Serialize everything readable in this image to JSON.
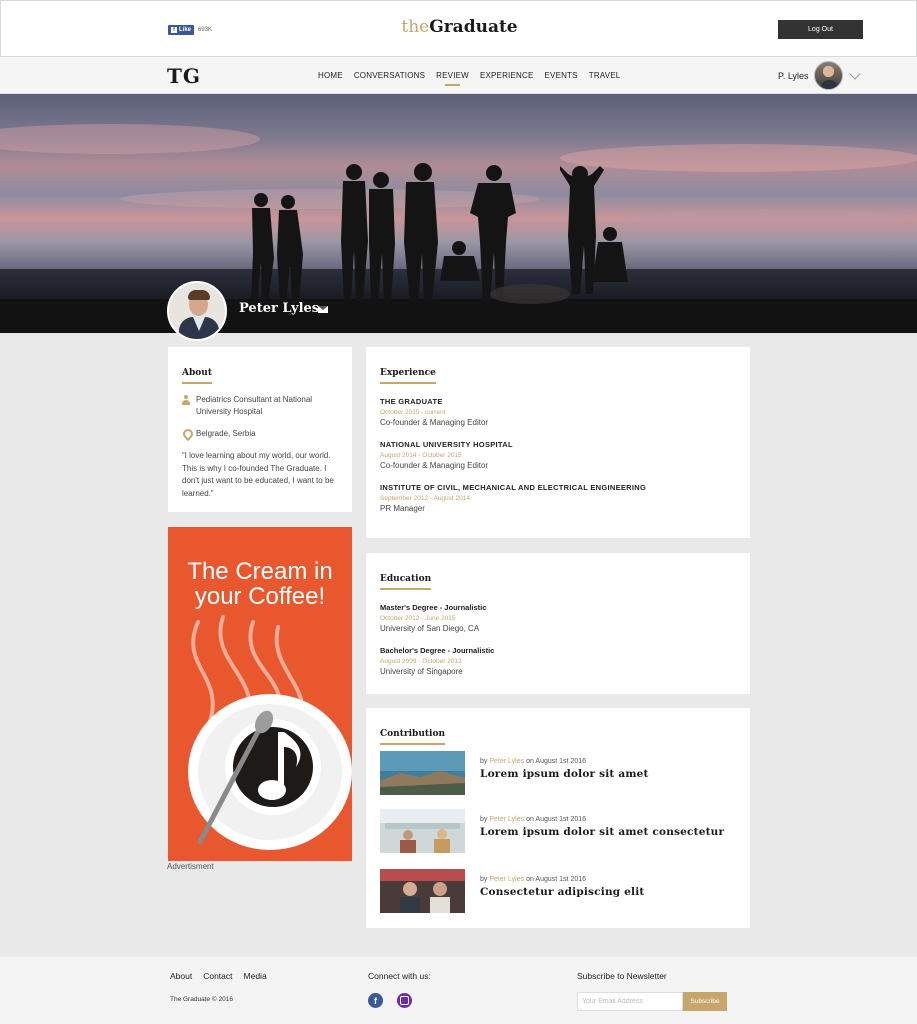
{
  "topbar": {
    "fb_like_label": "Like",
    "fb_count": "693K",
    "brand_prefix": "the",
    "brand_name": "Graduate",
    "logout_label": "Log Out"
  },
  "navbar": {
    "logo": "TG",
    "items": [
      "HOME",
      "CONVERSATIONS",
      "REVIEW",
      "EXPERIENCE",
      "EVENTS",
      "TRAVEL"
    ],
    "active_item": "REVIEW",
    "user_name": "P. Lyles"
  },
  "profile": {
    "name": "Peter Lyles"
  },
  "about": {
    "title": "About",
    "occupation": "Pediatrics Consultant at National University Hospital",
    "location": "Belgrade, Serbia",
    "quote": "“I love learning about my world, our world. This is why I co-founded The Graduate. I don't just want to be educated, I want to be learned.”"
  },
  "advertisement": {
    "headline_line1": "The Cream in",
    "headline_line2": "your Coffee!",
    "caption": "Advertisment"
  },
  "experience": {
    "title": "Experience",
    "items": [
      {
        "org": "THE GRADUATE",
        "dates": "October 2015 - current",
        "role": "Co-founder & Managing Editor"
      },
      {
        "org": "NATIONAL UNIVERSITY HOSPITAL",
        "dates": "August 2014 - October 2015",
        "role": "Co-founder & Managing Editor"
      },
      {
        "org": "INSTITUTE OF CIVIL, MECHANICAL AND ELECTRICAL ENGINEERING",
        "dates": "September 2012 - August 2014",
        "role": "PR Manager"
      }
    ]
  },
  "education": {
    "title": "Education",
    "items": [
      {
        "degree": "Master's Degree - Journalistic",
        "dates": "October 2012 - June 2015",
        "school": "University of San Diego, CA"
      },
      {
        "degree": "Bachelor's Degree - Journalistic",
        "dates": "August 2009 - October 2012",
        "school": "University of Singapore"
      }
    ]
  },
  "contribution": {
    "title": "Contribution",
    "posts": [
      {
        "by": "by",
        "author": "Peter Lyles",
        "date": "on August 1st 2016",
        "title": "Lorem ipsum dolor sit amet"
      },
      {
        "by": "by",
        "author": "Peter Lyles",
        "date": "on August 1st 2016",
        "title": "Lorem ipsum dolor sit amet consectetur"
      },
      {
        "by": "by",
        "author": "Peter Lyles",
        "date": "on August 1st 2016",
        "title": "Consectetur adipiscing elit"
      }
    ]
  },
  "footer": {
    "links": [
      "About",
      "Contact",
      "Media"
    ],
    "copyright": "The Graduate © 2016",
    "connect_label": "Connect with us:",
    "newsletter_label": "Subscribe to Newsletter",
    "email_placeholder": "Your Email Address",
    "subscribe_label": "Subscribe"
  },
  "colors": {
    "accent": "#c6a66b",
    "ad_background": "#e9572f",
    "facebook": "#3b5998",
    "instagram": "#6e2aa8",
    "dark_button": "#333333"
  }
}
